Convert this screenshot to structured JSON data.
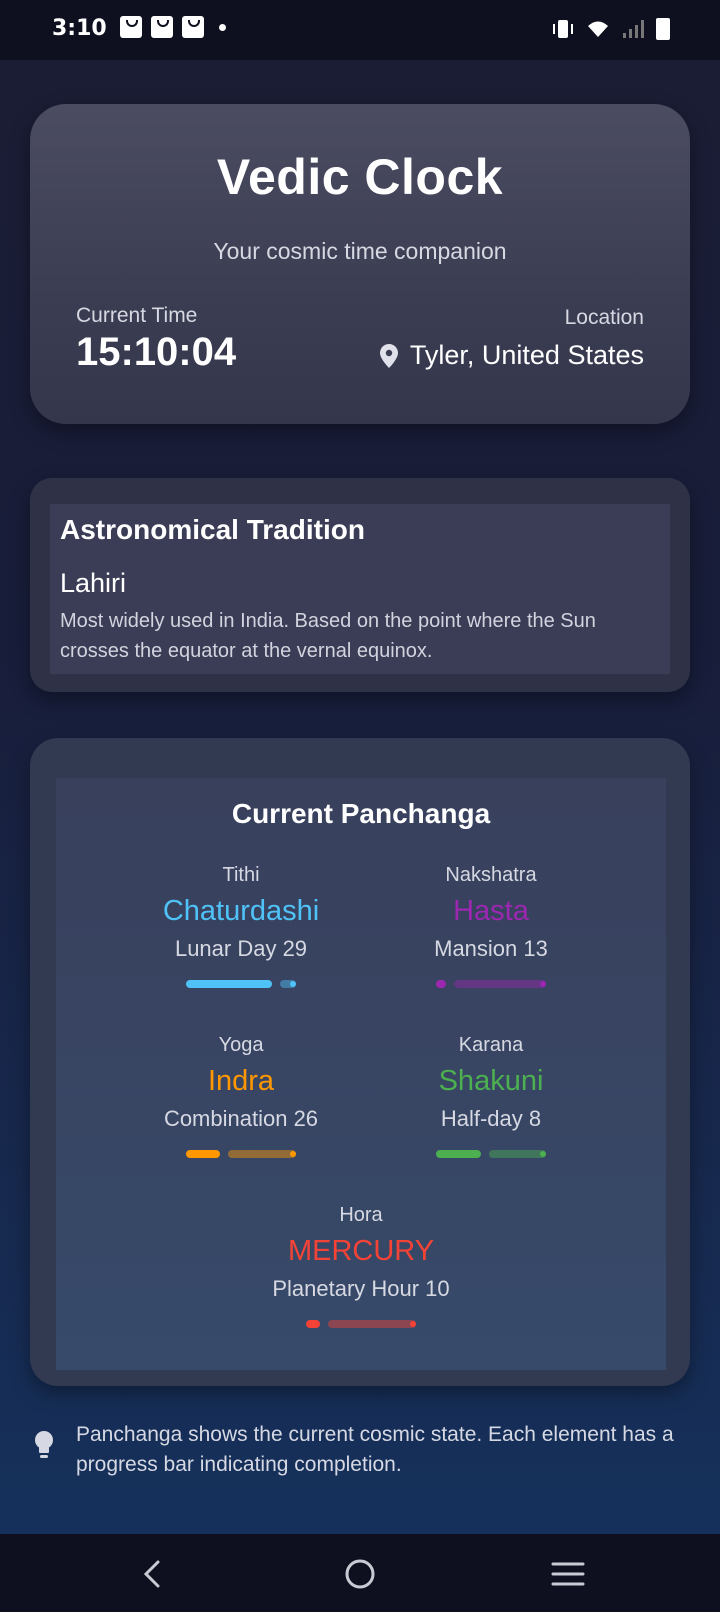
{
  "status_bar": {
    "time": "3:10",
    "notification_icons": [
      "shopping-bag-icon",
      "shopping-bag-icon",
      "shopping-bag-icon",
      "dot-icon"
    ],
    "system_icons": [
      "vibrate-icon",
      "wifi-icon",
      "signal-icon",
      "battery-icon"
    ]
  },
  "header": {
    "title": "Vedic Clock",
    "subtitle": "Your cosmic time companion",
    "time_label": "Current Time",
    "time_value": "15:10:04",
    "location_label": "Location",
    "location_value": "Tyler, United States"
  },
  "tradition": {
    "title": "Astronomical Tradition",
    "name": "Lahiri",
    "description": "Most widely used in India. Based on the point where the Sun crosses the equator at the vernal equinox."
  },
  "panchanga": {
    "title": "Current Panchanga",
    "items": [
      {
        "label": "Tithi",
        "value": "Chaturdashi",
        "sub": "Lunar Day 29",
        "color": "#4fc3f7",
        "progress": 0.85
      },
      {
        "label": "Nakshatra",
        "value": "Hasta",
        "sub": "Mansion 13",
        "color": "#9c27b0",
        "progress": 0.12
      },
      {
        "label": "Yoga",
        "value": "Indra",
        "sub": "Combination 26",
        "color": "#ff9800",
        "progress": 0.38
      },
      {
        "label": "Karana",
        "value": "Shakuni",
        "sub": "Half-day 8",
        "color": "#4caf50",
        "progress": 0.48
      },
      {
        "label": "Hora",
        "value": "MERCURY",
        "sub": "Planetary Hour 10",
        "color": "#f44336",
        "progress": 0.2
      }
    ]
  },
  "hint": {
    "icon": "lightbulb-icon",
    "text": "Panchanga shows the current cosmic state. Each element has a progress bar indicating completion."
  },
  "nav_bar": {
    "back": "back-icon",
    "home": "home-icon",
    "menu": "menu-icon"
  }
}
